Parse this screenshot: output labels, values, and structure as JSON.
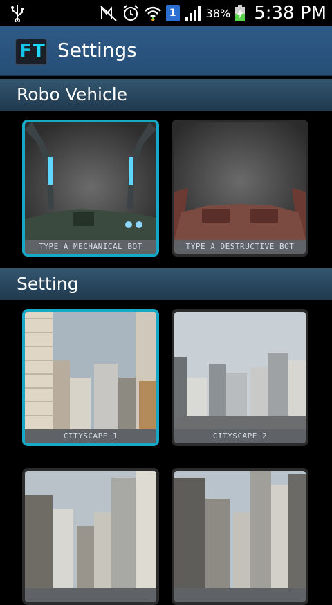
{
  "status_bar": {
    "battery_percent": "38%",
    "time": "5:38 PM",
    "sim_number": "1",
    "icons": [
      "usb-icon",
      "no-signal-icon",
      "alarm-icon",
      "wifi-icon",
      "sim-icon",
      "signal-icon",
      "battery-charging-icon"
    ]
  },
  "app_bar": {
    "logo_letters": [
      "F",
      "T"
    ],
    "title": "Settings"
  },
  "sections": [
    {
      "title": "Robo Vehicle",
      "cards": [
        {
          "caption": "TYPE A MECHANICAL BOT",
          "selected": true
        },
        {
          "caption": "TYPE A DESTRUCTIVE BOT",
          "selected": false
        }
      ]
    },
    {
      "title": "Setting",
      "cards": [
        {
          "caption": "CITYSCAPE 1",
          "selected": true
        },
        {
          "caption": "CITYSCAPE 2",
          "selected": false
        },
        {
          "caption": "",
          "selected": false
        },
        {
          "caption": "",
          "selected": false
        }
      ]
    }
  ],
  "colors": {
    "app_bar": "#2d5a86",
    "selected_border": "#17a7c7",
    "caption_bg": "#5f6367"
  }
}
